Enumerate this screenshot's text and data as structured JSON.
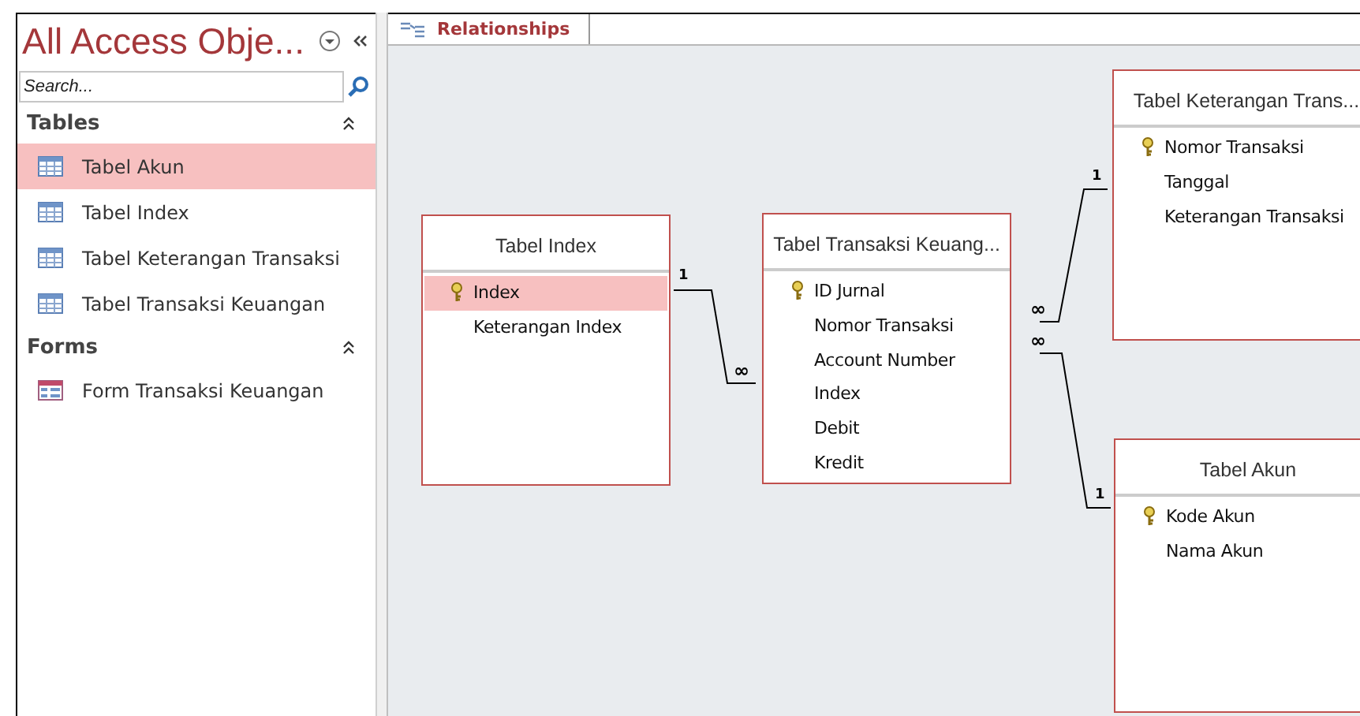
{
  "nav_pane": {
    "title": "All Access Obje...",
    "search": {
      "placeholder": "Search..."
    },
    "groups": [
      {
        "label": "Tables",
        "expanded": true,
        "items": [
          {
            "label": "Tabel Akun",
            "kind": "table",
            "selected": true
          },
          {
            "label": "Tabel Index",
            "kind": "table",
            "selected": false
          },
          {
            "label": "Tabel Keterangan Transaksi",
            "kind": "table",
            "selected": false
          },
          {
            "label": "Tabel Transaksi Keuangan",
            "kind": "table",
            "selected": false
          }
        ]
      },
      {
        "label": "Forms",
        "expanded": true,
        "items": [
          {
            "label": "Form Transaksi Keuangan",
            "kind": "form",
            "selected": false
          }
        ]
      }
    ]
  },
  "tabs": [
    {
      "label": "Relationships",
      "selected": true
    }
  ],
  "tables": [
    {
      "title": "Tabel Index",
      "fields": [
        {
          "name": "Index",
          "primary_key": true,
          "selected": true
        },
        {
          "name": "Keterangan Index",
          "primary_key": false,
          "selected": false
        }
      ]
    },
    {
      "title": "Tabel Transaksi Keuang...",
      "fields": [
        {
          "name": "ID Jurnal",
          "primary_key": true,
          "selected": false
        },
        {
          "name": "Nomor Transaksi",
          "primary_key": false,
          "selected": false
        },
        {
          "name": "Account Number",
          "primary_key": false,
          "selected": false
        },
        {
          "name": "Index",
          "primary_key": false,
          "selected": false
        },
        {
          "name": "Debit",
          "primary_key": false,
          "selected": false
        },
        {
          "name": "Kredit",
          "primary_key": false,
          "selected": false
        }
      ]
    },
    {
      "title": "Tabel Keterangan Trans...",
      "fields": [
        {
          "name": "Nomor Transaksi",
          "primary_key": true,
          "selected": false
        },
        {
          "name": "Tanggal",
          "primary_key": false,
          "selected": false
        },
        {
          "name": "Keterangan Transaksi",
          "primary_key": false,
          "selected": false
        }
      ]
    },
    {
      "title": "Tabel Akun",
      "fields": [
        {
          "name": "Kode Akun",
          "primary_key": true,
          "selected": false
        },
        {
          "name": "Nama Akun",
          "primary_key": false,
          "selected": false
        }
      ]
    }
  ],
  "relationships": [
    {
      "one_label": "1",
      "many_label": "∞"
    },
    {
      "one_label": "1",
      "many_label": "∞"
    },
    {
      "one_label": "1",
      "many_label": "∞"
    }
  ]
}
